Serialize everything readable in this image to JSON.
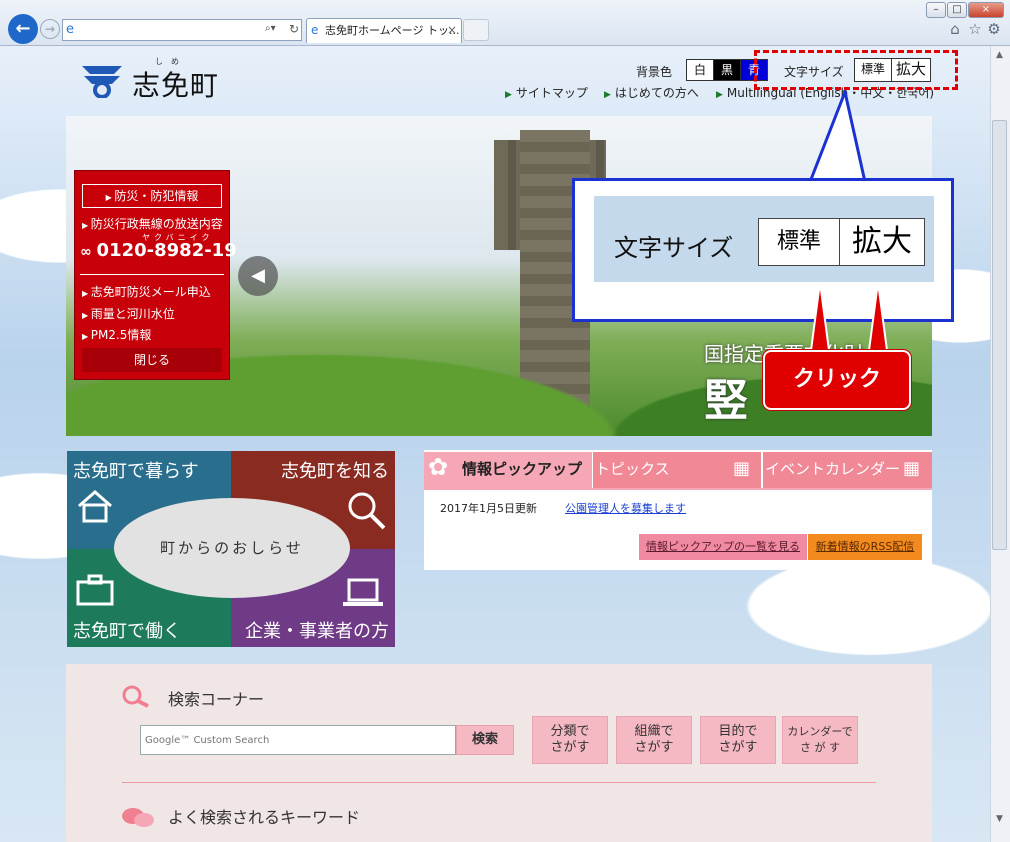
{
  "browser": {
    "tab_title": "志免町ホームページ トッ...",
    "tab_close": "×",
    "win_min": "–",
    "win_max": "□",
    "win_close": "×"
  },
  "header": {
    "site_name": "志免町",
    "site_name_ruby": "し　め",
    "bg_color_label": "背景色",
    "bg_white": "白",
    "bg_black": "黒",
    "bg_blue": "青",
    "font_size_label": "文字サイズ",
    "font_std": "標準",
    "font_big": "拡大",
    "nav": [
      "サイトマップ",
      "はじめての方へ",
      "Multilingual (English・中文・한국어)"
    ]
  },
  "hero": {
    "caption_line1": "国指定重要文化財",
    "caption_line2": "竪"
  },
  "disaster": {
    "top_button": "防災・防犯情報",
    "broadcast": "防災行政無線の放送内容",
    "phone": "0120-8982-19",
    "phone_kana": "ヤクバニイク",
    "mail": "志免町防災メール申込",
    "rain": "雨量と河川水位",
    "pm": "PM2.5情報",
    "close": "閉じる"
  },
  "callout": {
    "label": "文字サイズ",
    "std": "標準",
    "big": "拡大",
    "click": "クリック"
  },
  "tiles": {
    "live": "志免町で暮らす",
    "know": "志免町を知る",
    "work": "志免町で働く",
    "biz": "企業・事業者の方",
    "center": "町からのおしらせ"
  },
  "info": {
    "tabs": [
      "情報ピックアップ",
      "トピックス",
      "イベントカレンダー"
    ],
    "news_date": "2017年1月5日更新",
    "news_link": "公園管理人を募集します",
    "list_btn": "情報ピックアップの一覧を見る",
    "rss_btn": "新着情報のRSS配信"
  },
  "search": {
    "title": "検索コーナー",
    "placeholder": "Google™ Custom Search",
    "button": "検索",
    "by_category": "分類で\nさがす",
    "by_org": "組織で\nさがす",
    "by_purpose": "目的で\nさがす",
    "by_calendar": "カレンダーで\nさ が す",
    "keywords_title": "よく検索されるキーワード"
  }
}
